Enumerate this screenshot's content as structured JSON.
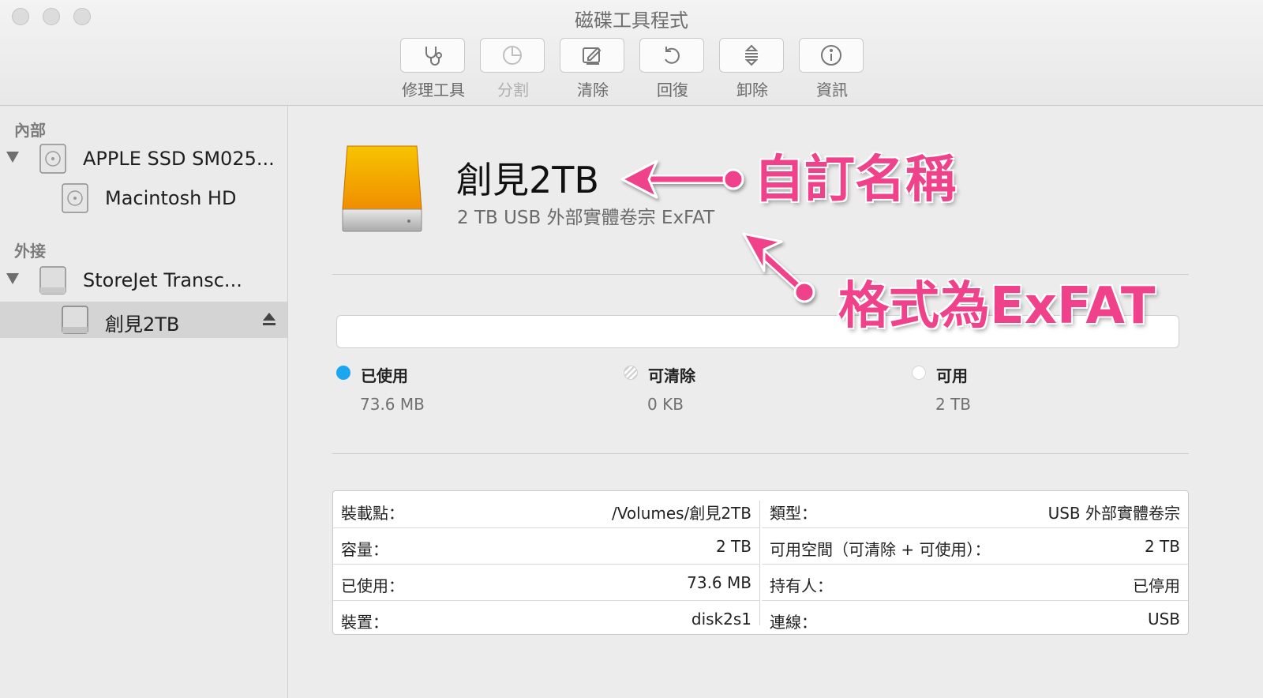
{
  "window": {
    "title": "磁碟工具程式"
  },
  "toolbar": {
    "items": [
      {
        "label": "修理工具",
        "icon": "stethoscope-icon",
        "enabled": true
      },
      {
        "label": "分割",
        "icon": "partition-pie-icon",
        "enabled": false
      },
      {
        "label": "清除",
        "icon": "erase-icon",
        "enabled": true
      },
      {
        "label": "回復",
        "icon": "restore-icon",
        "enabled": true
      },
      {
        "label": "卸除",
        "icon": "unmount-icon",
        "enabled": true
      },
      {
        "label": "資訊",
        "icon": "info-icon",
        "enabled": true
      }
    ]
  },
  "sidebar": {
    "internal_title": "內部",
    "external_title": "外接",
    "internal_items": [
      {
        "label": "APPLE SSD SM025...",
        "icon": "internal-disk-icon"
      },
      {
        "label": "Macintosh HD",
        "icon": "internal-volume-icon"
      }
    ],
    "external_items": [
      {
        "label": "StoreJet Transc...",
        "icon": "external-disk-icon"
      },
      {
        "label": "創見2TB",
        "icon": "external-volume-icon",
        "selected": true
      }
    ]
  },
  "volume": {
    "name": "創見2TB",
    "subtitle": "2 TB USB 外部實體卷宗 ExFAT",
    "icon": "external-drive-orange-icon"
  },
  "usage": {
    "used_fraction": 3.68e-05,
    "legend": [
      {
        "label": "已使用",
        "value": "73.6 MB",
        "color": "#1aa7ef"
      },
      {
        "label": "可清除",
        "value": "0 KB",
        "color": "#ffffff"
      },
      {
        "label": "可用",
        "value": "2 TB",
        "color": "#ffffff"
      }
    ]
  },
  "info": {
    "left": [
      {
        "k": "裝載點：",
        "v": "/Volumes/創見2TB"
      },
      {
        "k": "容量：",
        "v": "2 TB"
      },
      {
        "k": "已使用：",
        "v": "73.6 MB"
      },
      {
        "k": "裝置：",
        "v": "disk2s1"
      }
    ],
    "right": [
      {
        "k": "類型：",
        "v": "USB 外部實體卷宗"
      },
      {
        "k": "可用空間（可清除 + 可使用）：",
        "v": "2 TB"
      },
      {
        "k": "持有人：",
        "v": "已停用"
      },
      {
        "k": "連線：",
        "v": "USB"
      }
    ]
  },
  "annotations": {
    "custom_name": "自訂名稱",
    "format": "格式為ExFAT",
    "color": "#f0428a"
  }
}
